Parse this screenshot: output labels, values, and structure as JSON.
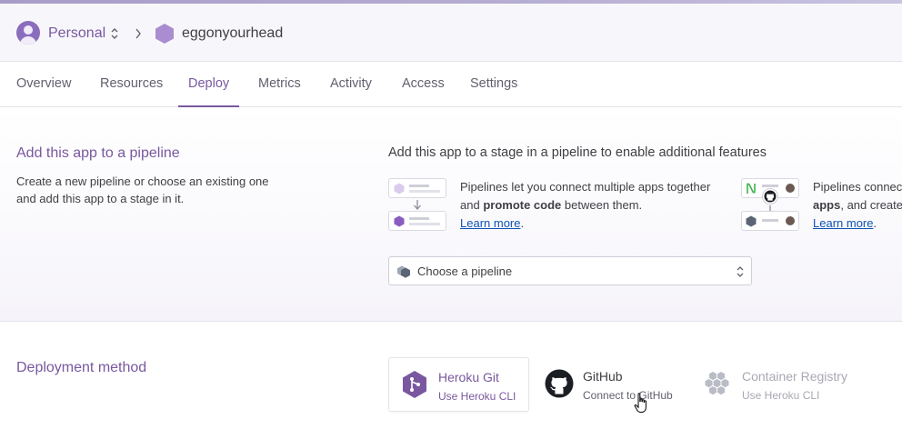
{
  "header": {
    "account_name": "Personal",
    "app_name": "eggonyourhead"
  },
  "tabs": [
    {
      "label": "Overview"
    },
    {
      "label": "Resources"
    },
    {
      "label": "Deploy"
    },
    {
      "label": "Metrics"
    },
    {
      "label": "Activity"
    },
    {
      "label": "Access"
    },
    {
      "label": "Settings"
    }
  ],
  "active_tab": "Deploy",
  "pipeline": {
    "title": "Add this app to a pipeline",
    "description": "Create a new pipeline or choose an existing one and add this app to a stage in it.",
    "stage_heading": "Add this app to a stage in a pipeline to enable additional features",
    "feature1": {
      "text_before": "Pipelines let you connect multiple apps together and ",
      "text_bold": "promote code",
      "text_after": " between them.",
      "link": "Learn more",
      "link_suffix": "."
    },
    "feature2": {
      "text_line1": "Pipelines connec",
      "text_bold": "apps",
      "text_after": ", and create",
      "link": "Learn more",
      "link_suffix": "."
    },
    "select_placeholder": "Choose a pipeline"
  },
  "deployment": {
    "title": "Deployment method",
    "methods": [
      {
        "title": "Heroku Git",
        "subtitle": "Use Heroku CLI",
        "icon": "heroku-git-icon",
        "selected": true
      },
      {
        "title": "GitHub",
        "subtitle": "Connect to GitHub",
        "icon": "github-icon",
        "selected": false
      },
      {
        "title": "Container Registry",
        "subtitle": "Use Heroku CLI",
        "icon": "container-registry-icon",
        "selected": false
      }
    ]
  },
  "colors": {
    "brand_purple": "#79589f",
    "link_blue": "#0f53b4",
    "text_dark": "#3f3f44",
    "muted": "#a8a8b3"
  }
}
